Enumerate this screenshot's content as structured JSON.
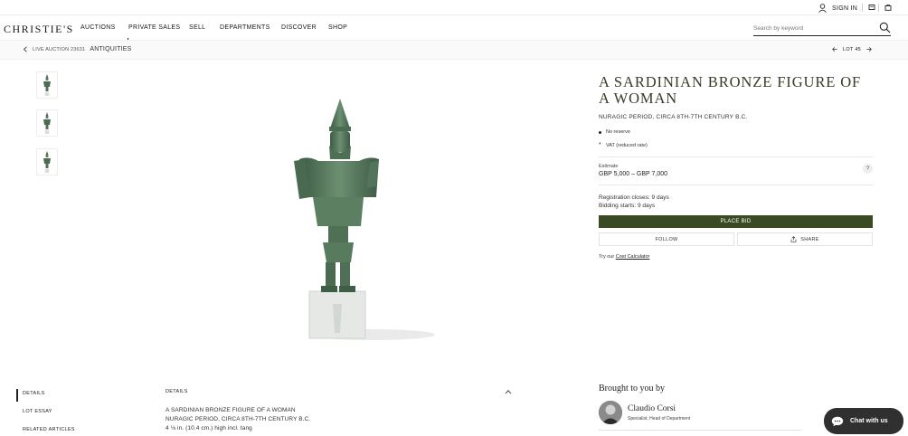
{
  "header": {
    "signin_label": "SIGN IN",
    "icons": [
      "user-icon",
      "heart-list-icon",
      "bag-icon"
    ]
  },
  "nav": {
    "logo": "CHRISTIE'S",
    "items": [
      "AUCTIONS",
      "PRIVATE SALES",
      "SELL",
      "DEPARTMENTS",
      "DISCOVER",
      "SHOP"
    ],
    "search_placeholder": "Search by keyword"
  },
  "breadcrumb": {
    "auction": "LIVE AUCTION 23631",
    "category": "ANTIQUITIES",
    "lot_label": "LOT 45"
  },
  "gallery": {
    "thumbnails": 3
  },
  "lot": {
    "title": "A SARDINIAN BRONZE FIGURE OF A WOMAN",
    "subtitle": "NURAGIC PERIOD, CIRCA 8TH-7TH CENTURY B.C.",
    "no_reserve": "No reserve",
    "vat": "VAT (reduced rate)",
    "estimate_label": "Estimate",
    "estimate_value": "GBP 5,000 – GBP 7,000",
    "help": "?",
    "registration_label": "Registration closes:",
    "registration_value": "9 days",
    "bidding_label": "Bidding starts:",
    "bidding_value": "9 days",
    "place_bid": "PLACE BID",
    "follow": "FOLLOW",
    "share": "SHARE",
    "cost_prefix": "Try our",
    "cost_link": "Cost Calculator"
  },
  "tabs": [
    "DETAILS",
    "LOT ESSAY",
    "RELATED ARTICLES"
  ],
  "details": {
    "heading": "DETAILS",
    "lines": [
      "A SARDINIAN BRONZE FIGURE OF A WOMAN",
      "NURAGIC PERIOD, CIRCA 8TH-7TH CENTURY B.C.",
      "4 ⅛ in. (10.4 cm.) high incl. tang"
    ]
  },
  "specialist": {
    "heading": "Brought to you by",
    "name": "Claudio Corsi",
    "role": "Specialist, Head of Department"
  },
  "chat": {
    "label": "Chat with us"
  },
  "colors": {
    "accent": "#3a4a22",
    "chat_bg": "#303030"
  }
}
